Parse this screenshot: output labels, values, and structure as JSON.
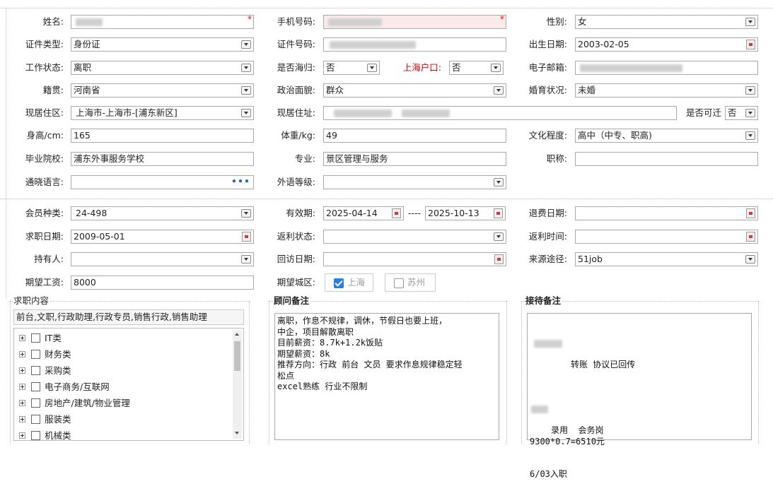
{
  "personal": {
    "name_label": "姓名:",
    "phone_label": "手机号码:",
    "gender_label": "性别:",
    "gender_value": "女",
    "id_type_label": "证件类型:",
    "id_type_value": "身份证",
    "id_number_label": "证件号码:",
    "birth_label": "出生日期:",
    "birth_value": "2003-02-05",
    "work_status_label": "工作状态:",
    "work_status_value": "离职",
    "returnee_label": "是否海归:",
    "returnee_value": "否",
    "shanghai_hukou_label": "上海户口:",
    "shanghai_hukou_value": "否",
    "email_label": "电子邮箱:",
    "native_label": "籍贯:",
    "native_value": "河南省",
    "political_label": "政治面貌:",
    "political_value": "群众",
    "marital_label": "婚育状况:",
    "marital_value": "未婚",
    "residence_area_label": "现居住区:",
    "residence_area_value": "上海市-上海市-[浦东新区]",
    "residence_addr_label": "现居住址:",
    "relocate_label": "是否可迁",
    "relocate_value": "否",
    "height_label": "身高/cm:",
    "height_value": "165",
    "weight_label": "体重/kg:",
    "weight_value": "49",
    "education_label": "文化程度:",
    "education_value": "高中（中专、职高)",
    "school_label": "毕业院校:",
    "school_value": "浦东外事服务学校",
    "major_label": "专业:",
    "major_value": "景区管理与服务",
    "title_label": "职称:",
    "language_label": "通晓语言:",
    "language_more": "•••",
    "lang_level_label": "外语等级:",
    "required_mark": "*"
  },
  "membership": {
    "member_type_label": "会员种类:",
    "member_type_value": "24-498",
    "validity_label": "有效期:",
    "valid_from": "2025-04-14",
    "valid_sep": "----",
    "valid_to": "2025-10-13",
    "refund_date_label": "退费日期:",
    "job_date_label": "求职日期:",
    "job_date_value": "2009-05-01",
    "rebate_status_label": "返利状态:",
    "rebate_time_label": "返利时间:",
    "holder_label": "持有人:",
    "revisit_label": "回访日期:",
    "source_label": "来源途径:",
    "source_value": "51job",
    "salary_label": "期望工资:",
    "salary_value": "8000",
    "city_label": "期望城区:",
    "city_options": [
      {
        "label": "上海",
        "checked": true
      },
      {
        "label": "苏州",
        "checked": false
      }
    ]
  },
  "job_content": {
    "title": "求职内容",
    "selected": "前台,文职,行政助理,行政专员,销售行政,销售助理",
    "categories": [
      "IT类",
      "财务类",
      "采购类",
      "电子商务/互联网",
      "房地产/建筑/物业管理",
      "服装类",
      "机械类"
    ]
  },
  "advisor_notes": {
    "title": "顾问备注",
    "text": "离职，作息不规律，调休，节假日也要上班，\n中企，项目解散离职\n目前薪资：8.7k+1.2k饭贴\n期望薪资：8k\n推荐方向：行政 前台 文员 要求作息规律稳定轻\n松点\nexcel熟练 行业不限制"
  },
  "reception_notes": {
    "title": "接待备注",
    "line1": "转账 协议已回传",
    "line2": "录用  会务岗",
    "line3": "9300*0.7=6510元",
    "line4": "6/03入职"
  }
}
